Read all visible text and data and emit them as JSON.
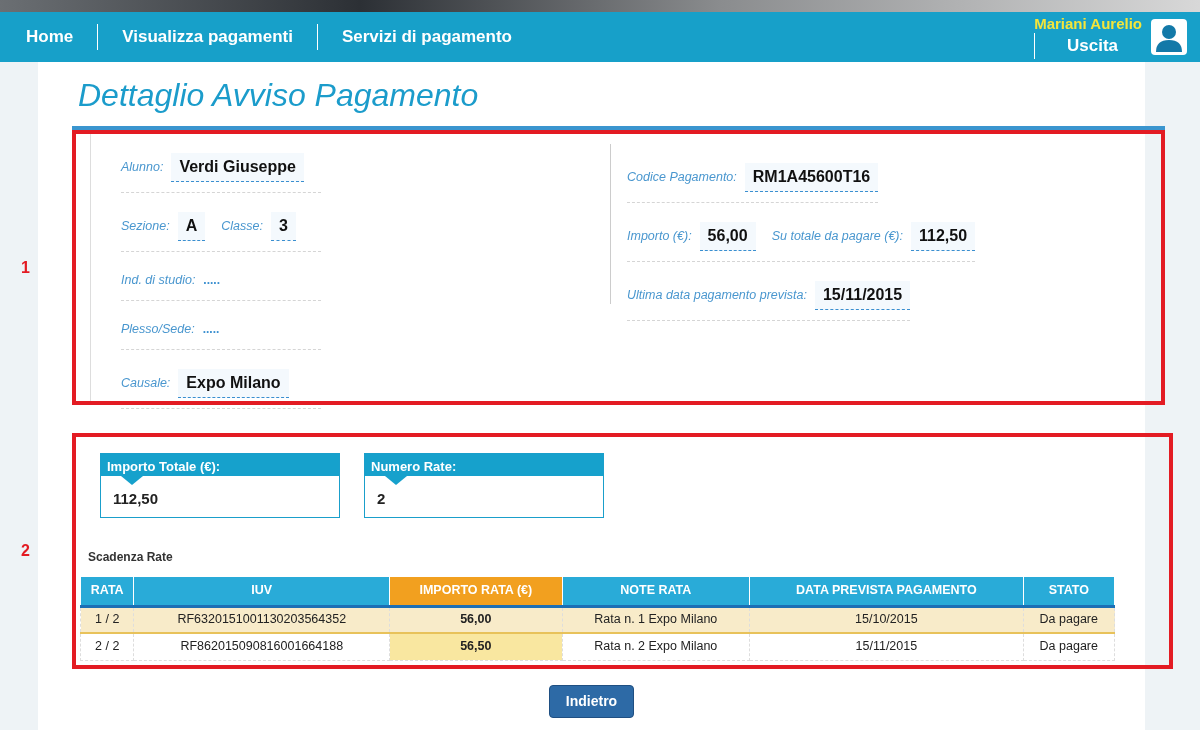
{
  "navbar": {
    "links": [
      {
        "label": "Home"
      },
      {
        "label": "Visualizza pagamenti"
      },
      {
        "label": "Servizi di pagamento"
      }
    ],
    "user": {
      "name": "Mariani Aurelio",
      "logout": "Uscita"
    }
  },
  "title": "Dettaglio Avviso Pagamento",
  "annotations": [
    "1",
    "2"
  ],
  "details": {
    "left": [
      [
        {
          "label": "Alunno:",
          "value": "Verdi Giuseppe"
        }
      ],
      [
        {
          "label": "Sezione:",
          "value": "A"
        },
        {
          "label": "Classe:",
          "value": "3"
        }
      ],
      [
        {
          "label": "Ind. di studio:",
          "value": "....."
        }
      ],
      [
        {
          "label": "Plesso/Sede:",
          "value": "....."
        }
      ],
      [
        {
          "label": "Causale:",
          "value": "Expo Milano"
        }
      ]
    ],
    "right": [
      [
        {
          "label": "Codice Pagamento:",
          "value": "RM1A45600T16"
        }
      ],
      [
        {
          "label": "Importo (€):",
          "value": "56,00"
        },
        {
          "label": "Su totale da pagare (€):",
          "value": "112,50"
        }
      ],
      [
        {
          "label": "Ultima data pagamento prevista:",
          "value": "15/11/2015"
        }
      ]
    ]
  },
  "summary": [
    {
      "label": "Importo Totale (€):",
      "value": "112,50"
    },
    {
      "label": "Numero Rate:",
      "value": "2"
    }
  ],
  "table": {
    "title": "Scadenza Rate",
    "columns": [
      {
        "label": "RATA",
        "highlighted": false
      },
      {
        "label": "IUV",
        "highlighted": false
      },
      {
        "label": "IMPORTO RATA (€)",
        "highlighted": true
      },
      {
        "label": "NOTE RATA",
        "highlighted": false
      },
      {
        "label": "DATA PREVISTA PAGAMENTO",
        "highlighted": false
      },
      {
        "label": "STATO",
        "highlighted": false
      }
    ],
    "rows": [
      {
        "selected": true,
        "cells": [
          "1 / 2",
          "RF6320151001130203564352",
          "56,00",
          "Rata n. 1 Expo Milano",
          "15/10/2015",
          "Da pagare"
        ]
      },
      {
        "selected": false,
        "cells": [
          "2 / 2",
          "RF862015090816001664188",
          "56,50",
          "Rata n. 2 Expo Milano",
          "15/11/2015",
          "Da pagare"
        ]
      }
    ]
  },
  "back_button": "Indietro"
}
